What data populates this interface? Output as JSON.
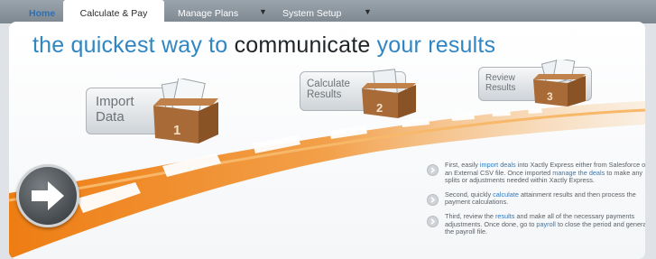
{
  "nav": {
    "tabs": [
      {
        "label": "Home"
      },
      {
        "label": "Calculate & Pay"
      },
      {
        "label": "Manage Plans"
      },
      {
        "label": "System Setup"
      }
    ]
  },
  "headline": {
    "part1": "the quickest way to",
    "part2": "communicate",
    "part3": "your results"
  },
  "steps": [
    {
      "line1": "Import",
      "line2": "Data",
      "number": "1"
    },
    {
      "line1": "Calculate",
      "line2": "Results",
      "number": "2"
    },
    {
      "line1": "Review",
      "line2": "Results",
      "number": "3"
    }
  ],
  "bullets": [
    {
      "pre": "First, easily ",
      "link1": "import deals",
      "mid": " into Xactly Express either from Salesforce or an External CSV file. Once imported ",
      "link2": "manage the deals",
      "post": " to make any splits or adjustments needed within Xactly Express."
    },
    {
      "pre": "Second, quickly ",
      "link1": "calculate",
      "post": " attainment results and then process the payment calculations."
    },
    {
      "pre": "Third, review the ",
      "link1": "results",
      "mid": " and make all of the necessary payments adjustments. Once done, go to ",
      "link2": "payroll",
      "post": " to close the period and generate the payroll file."
    }
  ],
  "colors": {
    "accent": "#2f86c3",
    "road": "#f08a1c"
  }
}
